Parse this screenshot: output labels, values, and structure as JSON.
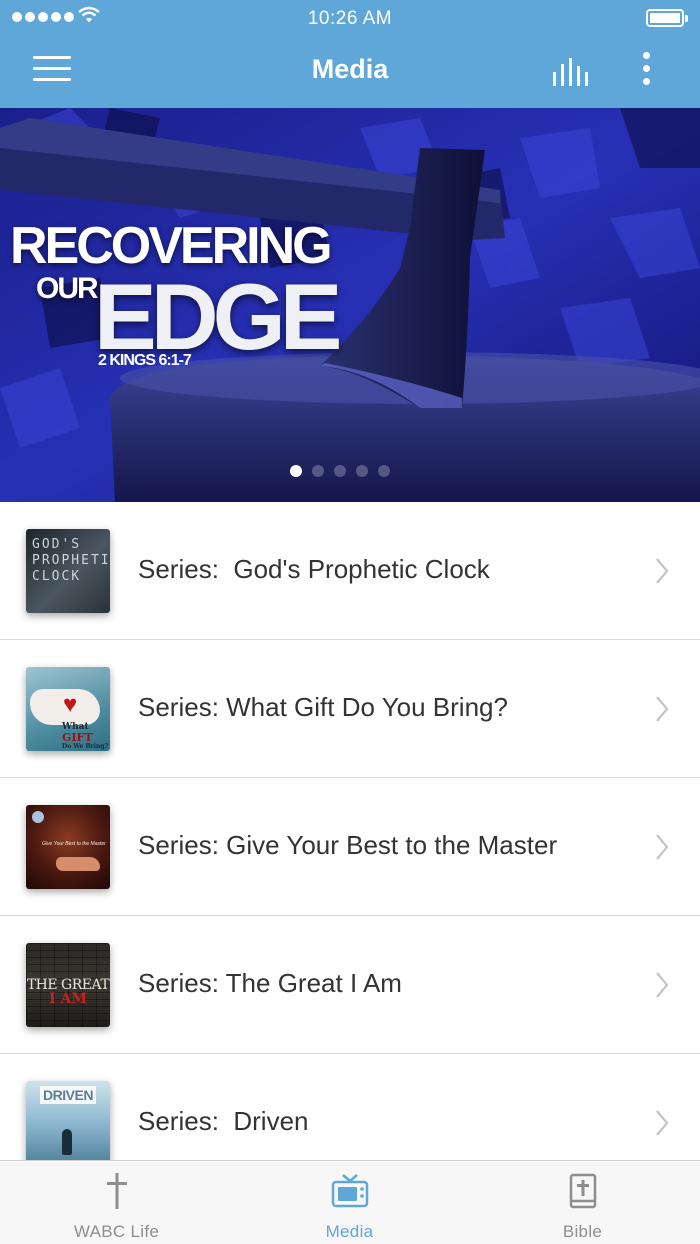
{
  "status_bar": {
    "time": "10:26 AM"
  },
  "nav": {
    "title": "Media",
    "menu_icon": "hamburger-menu-icon",
    "chart_icon": "equalizer-bars-icon",
    "more_icon": "vertical-dots-icon",
    "bar_color": "#5fa7d9"
  },
  "hero": {
    "line1": "RECOVERING",
    "line2": "OUR",
    "line3": "EDGE",
    "reference": "2 KINGS 6:1-7",
    "page_count": 5,
    "active_page": 1
  },
  "series": [
    {
      "label": "Series:  God's Prophetic Clock",
      "thumb_text": [
        "GOD'S",
        "PROPHETIC",
        "CLOCK"
      ]
    },
    {
      "label": "Series: What Gift Do You Bring?",
      "thumb_text": [
        "What",
        "GIFT",
        "Do We Bring?"
      ]
    },
    {
      "label": "Series: Give Your Best to the Master",
      "thumb_text": [
        "Give Your Best to the Master"
      ]
    },
    {
      "label": "Series: The Great I Am",
      "thumb_text": [
        "THE GREAT",
        "I AM"
      ]
    },
    {
      "label": "Series:  Driven",
      "thumb_text": [
        "DRIVEN"
      ]
    }
  ],
  "tabs": [
    {
      "label": "WABC Life",
      "icon": "cross-icon",
      "active": false
    },
    {
      "label": "Media",
      "icon": "tv-icon",
      "active": true
    },
    {
      "label": "Bible",
      "icon": "bible-book-icon",
      "active": false
    }
  ],
  "colors": {
    "accent": "#5fa7d9",
    "inactive_tab": "#8e8e8e",
    "row_text": "#333333"
  }
}
